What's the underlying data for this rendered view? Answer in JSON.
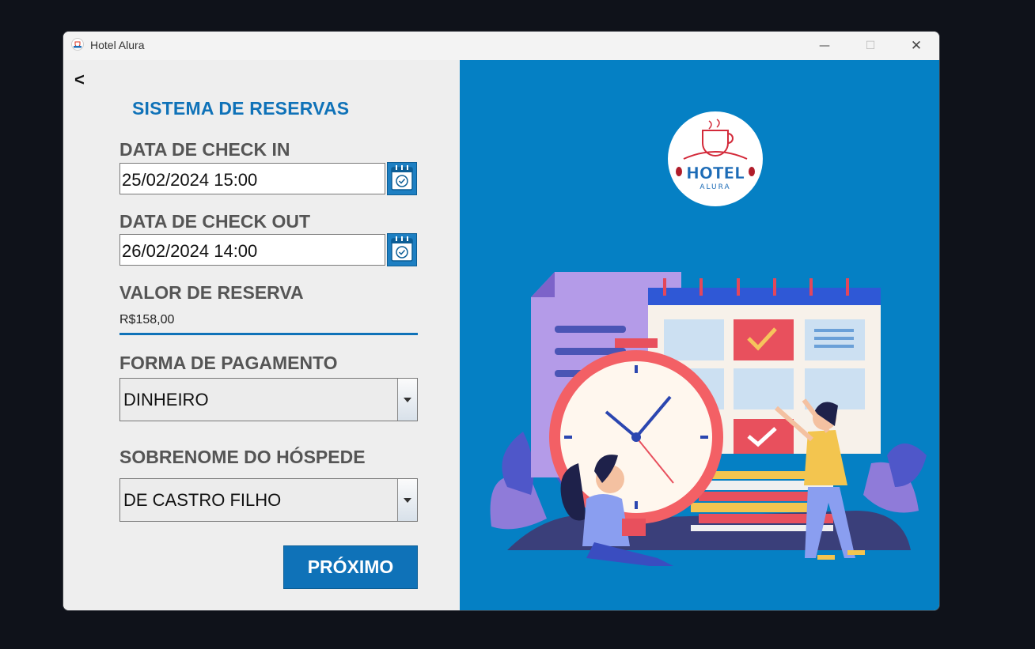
{
  "window": {
    "title": "Hotel Alura",
    "controls": {
      "minimize": "—",
      "maximize": "☐",
      "close": "✕"
    }
  },
  "left": {
    "back_label": "<",
    "heading": "SISTEMA DE RESERVAS",
    "checkin": {
      "label": "DATA DE CHECK IN",
      "value": "25/02/2024 15:00",
      "icon": "calendar-check-icon"
    },
    "checkout": {
      "label": "DATA DE CHECK OUT",
      "value": "26/02/2024 14:00",
      "icon": "calendar-check-icon"
    },
    "valor": {
      "label": "VALOR DE RESERVA",
      "value": "R$158,00"
    },
    "pagamento": {
      "label": "FORMA DE PAGAMENTO",
      "selected": "DINHEIRO"
    },
    "hospede": {
      "label": "SOBRENOME DO HÓSPEDE",
      "selected": "DE CASTRO FILHO"
    },
    "next_label": "PRÓXIMO"
  },
  "right": {
    "logo": {
      "line1": "HOTEL",
      "line2": "ALURA"
    }
  },
  "colors": {
    "accent": "#0f72b8",
    "panel": "#0580c4"
  }
}
